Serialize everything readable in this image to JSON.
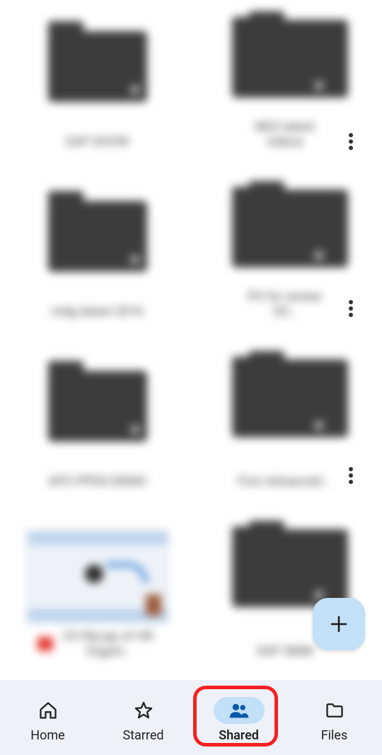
{
  "items": [
    {
      "type": "folder-single",
      "label": "SAP SHOW"
    },
    {
      "type": "folder-stack",
      "label": "NEO latest videos"
    },
    {
      "type": "folder-single",
      "label": "mdg latest 2016"
    },
    {
      "type": "folder-stack",
      "label": "PS for review OC.."
    },
    {
      "type": "folder-single",
      "label": "APO PPDS DEMO"
    },
    {
      "type": "folder-stack",
      "label": "Fiori Advanced .."
    },
    {
      "type": "file",
      "label": "CO Recap of HR Organi.."
    },
    {
      "type": "folder-stack",
      "label": "SAP SMM"
    }
  ],
  "nav": {
    "home": {
      "label": "Home",
      "active": false
    },
    "starred": {
      "label": "Starred",
      "active": false
    },
    "shared": {
      "label": "Shared",
      "active": true
    },
    "files": {
      "label": "Files",
      "active": false
    }
  },
  "fab": {
    "label": "+"
  },
  "colors": {
    "accent": "#c2e0f7",
    "folder": "#3c3c3c",
    "highlight": "#f42020",
    "navBg": "#eef2f8"
  }
}
